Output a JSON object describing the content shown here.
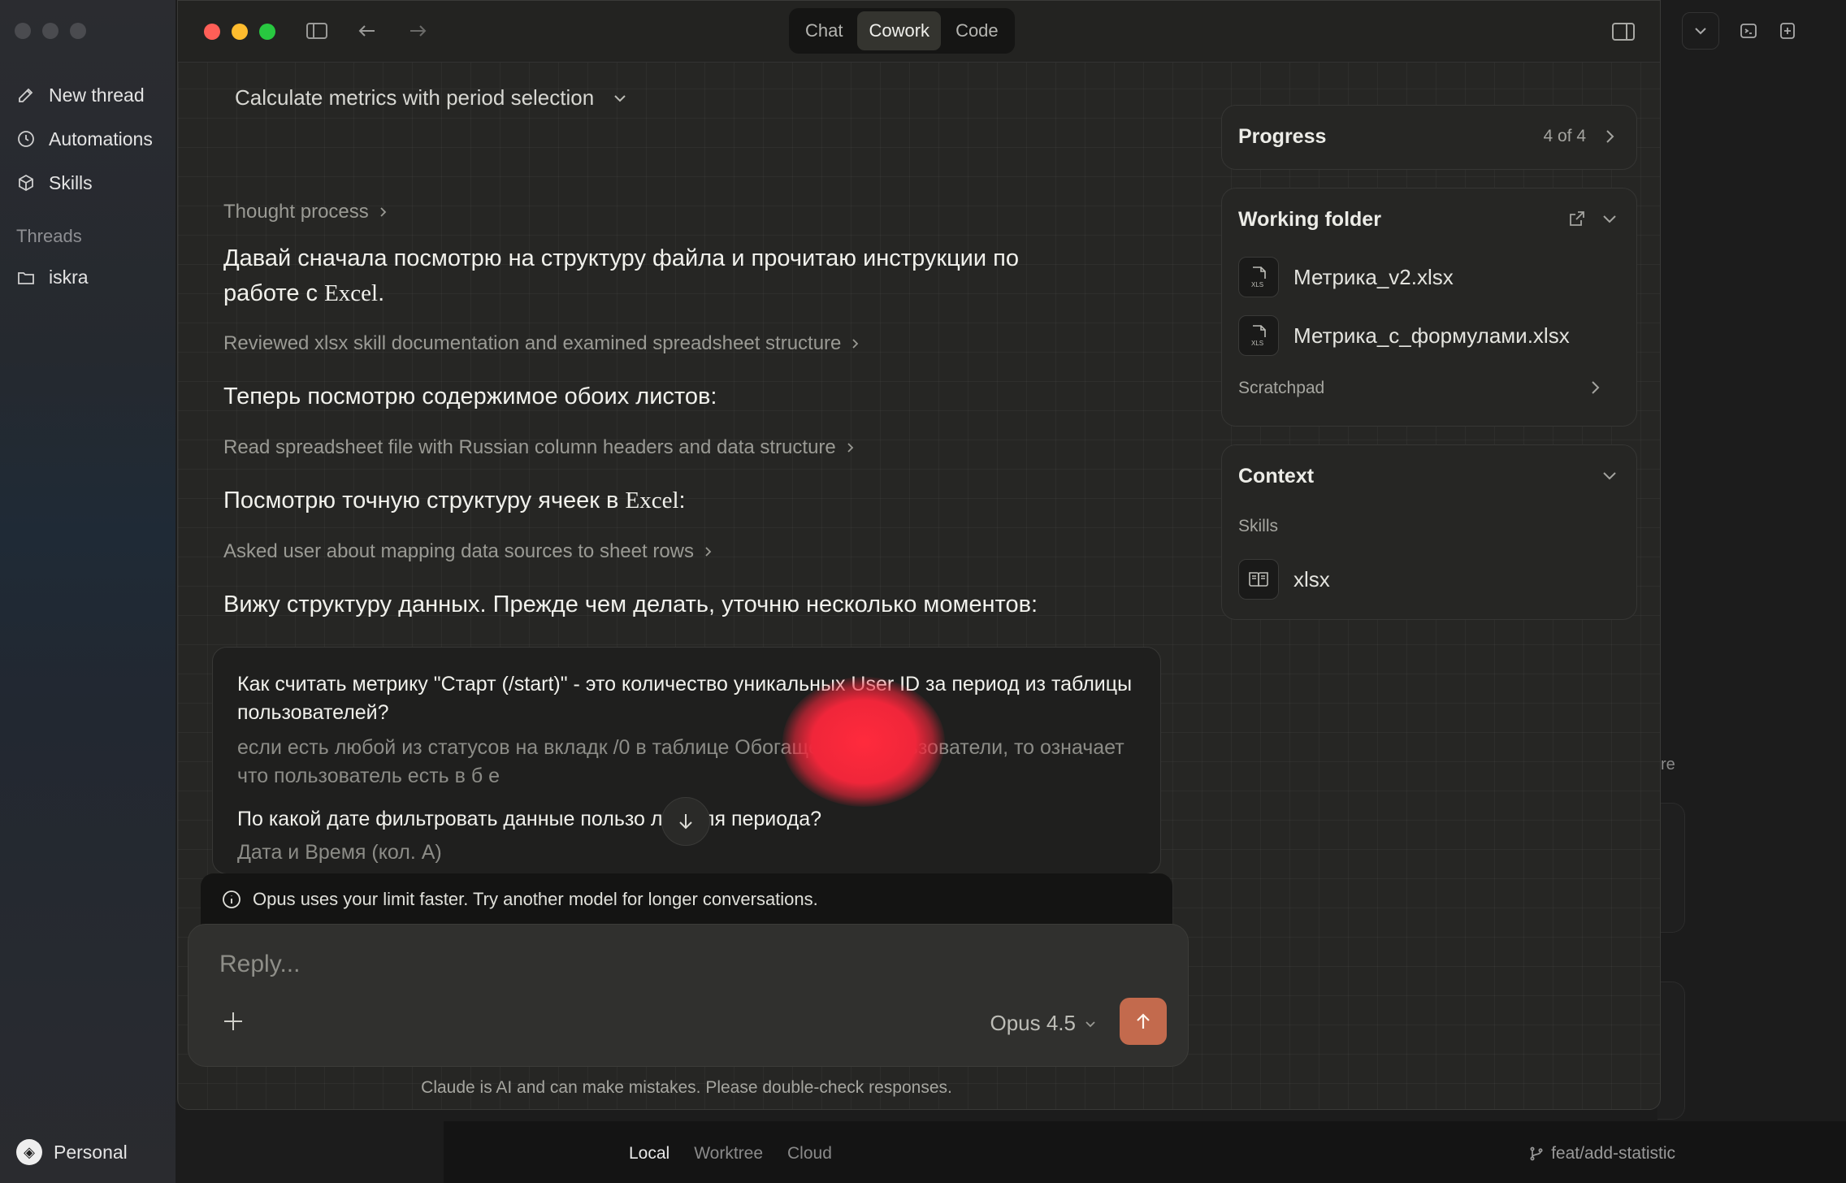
{
  "background_app": {
    "sidebar": {
      "items": [
        {
          "label": "New thread",
          "icon": "compose-icon"
        },
        {
          "label": "Automations",
          "icon": "clock-icon"
        },
        {
          "label": "Skills",
          "icon": "cube-icon"
        }
      ],
      "threads_heading": "Threads",
      "threads": [
        {
          "label": "iskra",
          "icon": "folder-icon"
        }
      ],
      "account": "Personal"
    },
    "bottom_tabs": [
      "Local",
      "Worktree",
      "Cloud"
    ],
    "active_bottom_tab": "Local",
    "branch": "feat/add-statistic",
    "partial_text": "re"
  },
  "window": {
    "modes": [
      "Chat",
      "Cowork",
      "Code"
    ],
    "active_mode": "Cowork"
  },
  "conversation": {
    "title": "Calculate metrics with period selection",
    "blocks": [
      {
        "type": "step",
        "text": "Thought process"
      },
      {
        "type": "text",
        "text_a": "Давай сначала посмотрю на структуру файла и прочитаю инструкции по работе с ",
        "text_serif": "Excel",
        "text_b": "."
      },
      {
        "type": "step",
        "text": "Reviewed xlsx skill documentation and examined spreadsheet structure"
      },
      {
        "type": "text",
        "text_a": "Теперь посмотрю содержимое обоих листов:",
        "text_serif": "",
        "text_b": ""
      },
      {
        "type": "step",
        "text": "Read spreadsheet file with Russian column headers and data structure"
      },
      {
        "type": "text",
        "text_a": "Посмотрю точную структуру ячеек в ",
        "text_serif": "Excel",
        "text_b": ":"
      },
      {
        "type": "step",
        "text": "Asked user about mapping data sources to sheet rows"
      },
      {
        "type": "text",
        "text_a": "Вижу структуру данных. Прежде чем делать, уточню несколько моментов:",
        "text_serif": "",
        "text_b": ""
      }
    ],
    "questions": [
      {
        "q": "Как считать метрику \"Старт (/start)\" - это количество уникальных User ID за период из таблицы пользователей?",
        "a": "если есть любой из статусов на вкладк  /0   в таблице Обогащённые пользователи, то означает что пользователь есть в б  е"
      },
      {
        "q": "По какой дате фильтровать данные пользо     лей для периода?",
        "a": "Дата и Время (кол. А)"
      }
    ]
  },
  "notice": "Opus uses your limit faster. Try another model for longer conversations.",
  "composer": {
    "placeholder": "Reply...",
    "model": "Opus 4.5"
  },
  "disclaimer": "Claude is AI and can make mistakes. Please double-check responses.",
  "panel": {
    "progress": {
      "title": "Progress",
      "status": "4 of 4"
    },
    "working_folder": {
      "title": "Working folder",
      "files": [
        {
          "name": "Метрика_v2.xlsx",
          "icon": "xls-file-icon"
        },
        {
          "name": "Метрика_с_формулами.xlsx",
          "icon": "xls-file-icon"
        }
      ],
      "scratchpad": "Scratchpad"
    },
    "context": {
      "title": "Context",
      "skills_label": "Skills",
      "skills": [
        {
          "name": "xlsx",
          "icon": "book-icon"
        }
      ]
    }
  },
  "colors": {
    "accent": "#c36a4d",
    "traffic_red": "#ff5f57",
    "traffic_yellow": "#febc2e",
    "traffic_green": "#28c840",
    "blot": "#f0263a"
  }
}
